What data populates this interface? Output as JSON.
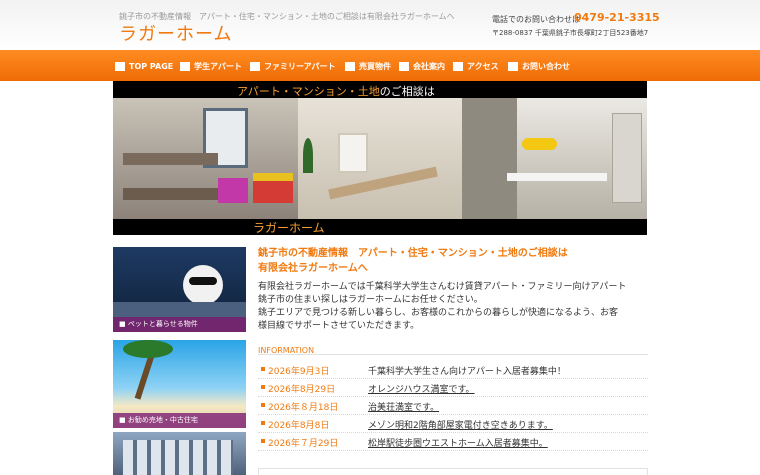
{
  "header": {
    "tagline": "銚子市の不動産情報　アパート・住宅・マンション・土地のご相談は有限会社ラガーホームへ",
    "logo": "ラガーホーム",
    "contact_label": "電話でのお問い合わせは",
    "contact_phone": "0479-21-3315",
    "contact_address": "〒288-0837 千葉県銚子市長塚町2丁目523番地7"
  },
  "nav": {
    "items": [
      {
        "label": "TOP PAGE"
      },
      {
        "label": "学生アパート"
      },
      {
        "label": "ファミリーアパート"
      },
      {
        "label": "売買物件"
      },
      {
        "label": "会社案内"
      },
      {
        "label": "アクセス"
      },
      {
        "label": "お問い合わせ"
      }
    ]
  },
  "hero": {
    "caption_orange": "アパート・マンション・土地",
    "caption_white": "のご相談は",
    "logo": "ラガーホーム"
  },
  "sidebar": {
    "cards": [
      {
        "label": "■ ペットと暮らせる物件"
      },
      {
        "label": "■ お勧め売地・中古住宅"
      }
    ]
  },
  "main": {
    "heading_line1": "銚子市の不動産情報　アパート・住宅・マンション・土地のご相談は",
    "heading_line2": "有限会社ラガーホームへ",
    "body_lines": [
      "有限会社ラガーホームでは千葉科学大学生さんむけ賃貸アパート・ファミリー向けアパート",
      "銚子市の住まい探しはラガーホームにお任せください。",
      "銚子エリアで見つける新しい暮らし、お客様のこれからの暮らしが快適になるよう、お客",
      "様目線でサポートさせていただきます。"
    ]
  },
  "information": {
    "title": "INFORMATION",
    "items": [
      {
        "date": "2026年9月3日",
        "text": "千葉科学大学生さん向けアパート入居者募集中！"
      },
      {
        "date": "2026年8月29日",
        "text": "オレンジハウス満室です。"
      },
      {
        "date": "2026年８月18日",
        "text": "治美荘満室です。"
      },
      {
        "date": "2026年8月8日",
        "text": "メゾン明和2階角部屋家電付き空きあります。"
      },
      {
        "date": "2026年７月29日",
        "text": "松岸駅徒歩圏ウエストホーム入居者募集中。"
      }
    ]
  },
  "colors": {
    "accent": "#f07a10",
    "nav": "#ef6b05",
    "card_label": "#82287a"
  }
}
